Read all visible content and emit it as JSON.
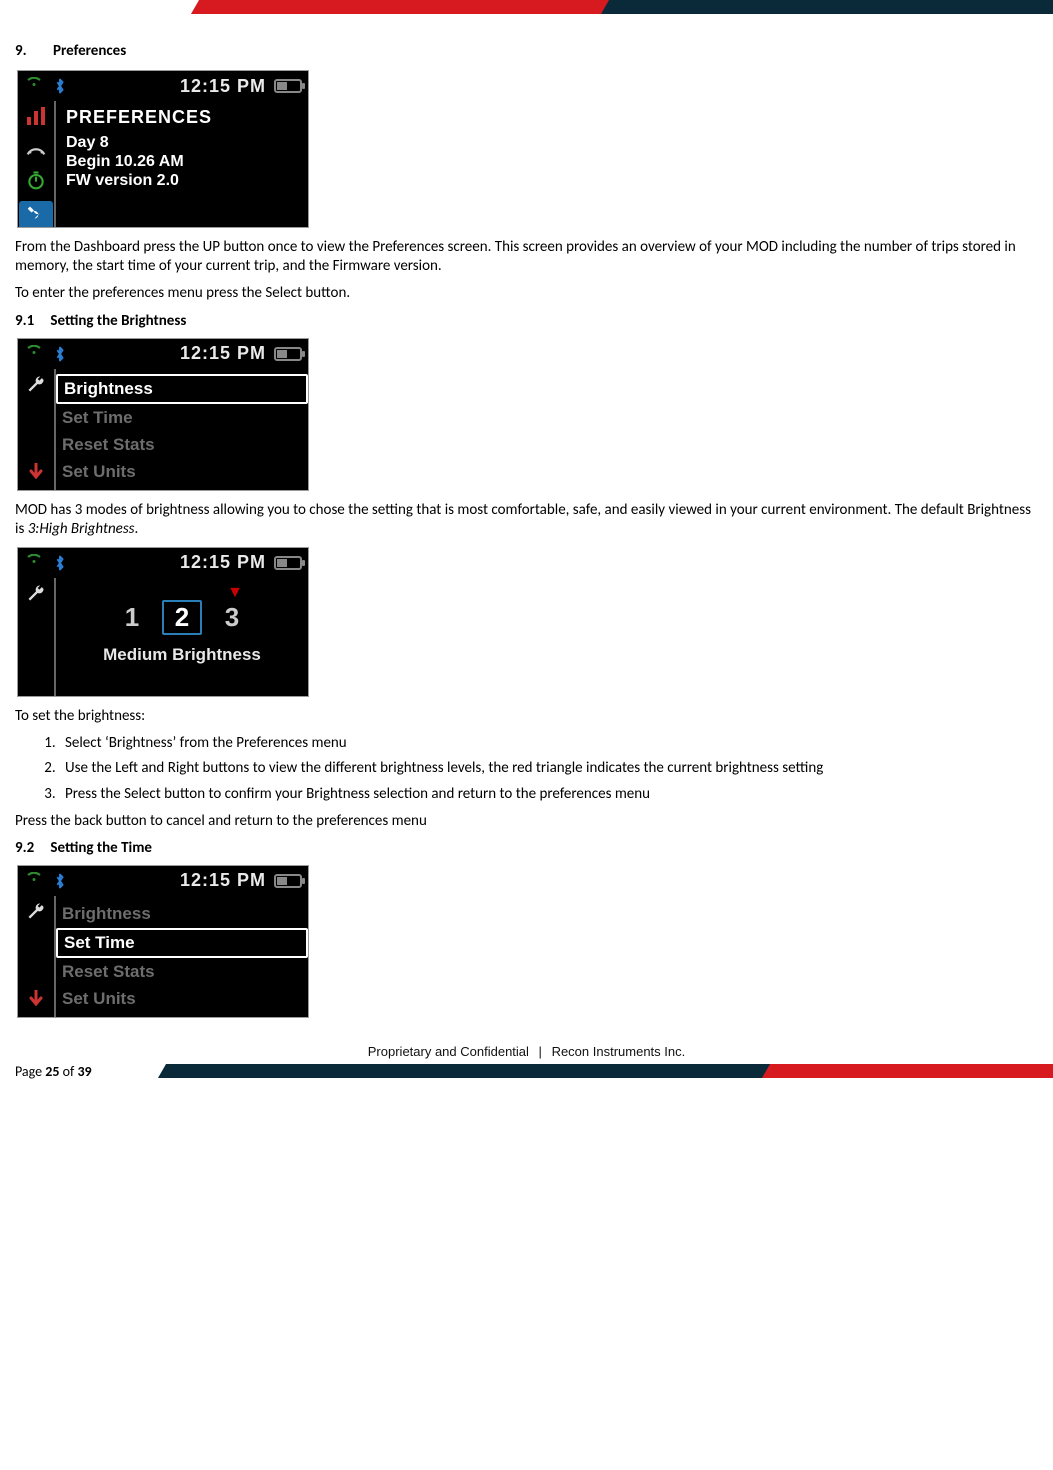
{
  "sec": {
    "num": "9.",
    "title": "Preferences"
  },
  "dev1": {
    "time": "12:15 PM",
    "h1": "PREFERENCES",
    "l1": "Day 8",
    "l2": "Begin 10.26 AM",
    "l3": "FW version 2.0"
  },
  "p1": "From the Dashboard press the UP button once to view the Preferences screen. This screen provides an overview of your MOD including the number of trips stored in memory, the start time of your current trip, and the Firmware version.",
  "p2": "To enter the preferences menu press the Select button.",
  "sub1": {
    "n": "9.1",
    "t": "Setting the Brightness"
  },
  "dev2": {
    "time": "12:15 PM",
    "m1": "Brightness",
    "m2": "Set Time",
    "m3": "Reset Stats",
    "m4": "Set Units"
  },
  "p3a": "MOD has 3 modes of brightness allowing you to chose the setting that is most comfortable, safe, and easily viewed in your current environment. The default Brightness is ",
  "p3b": "3:High Brightness",
  "p3c": ".",
  "dev3": {
    "time": "12:15 PM",
    "n1": "1",
    "n2": "2",
    "n3": "3",
    "lbl": "Medium Brightness"
  },
  "p4": "To set the brightness:",
  "steps": {
    "s1": "Select ‘Brightness’ from the Preferences menu",
    "s2": "Use the Left and Right buttons to view the different brightness levels, the red triangle indicates the current brightness setting",
    "s3": "Press the Select button to confirm your Brightness selection and return to the preferences menu"
  },
  "p5": "Press the back button to cancel and return to the preferences menu",
  "sub2": {
    "n": "9.2",
    "t": "Setting the Time"
  },
  "dev4": {
    "time": "12:15 PM",
    "m1": "Brightness",
    "m2": "Set Time",
    "m3": "Reset Stats",
    "m4": "Set Units"
  },
  "footer": {
    "conf": "Proprietary and Confidential",
    "sep": "|",
    "co": "Recon Instruments Inc.",
    "pageA": "Page ",
    "pageN": "25",
    "pageB": " of ",
    "pageT": "39"
  }
}
